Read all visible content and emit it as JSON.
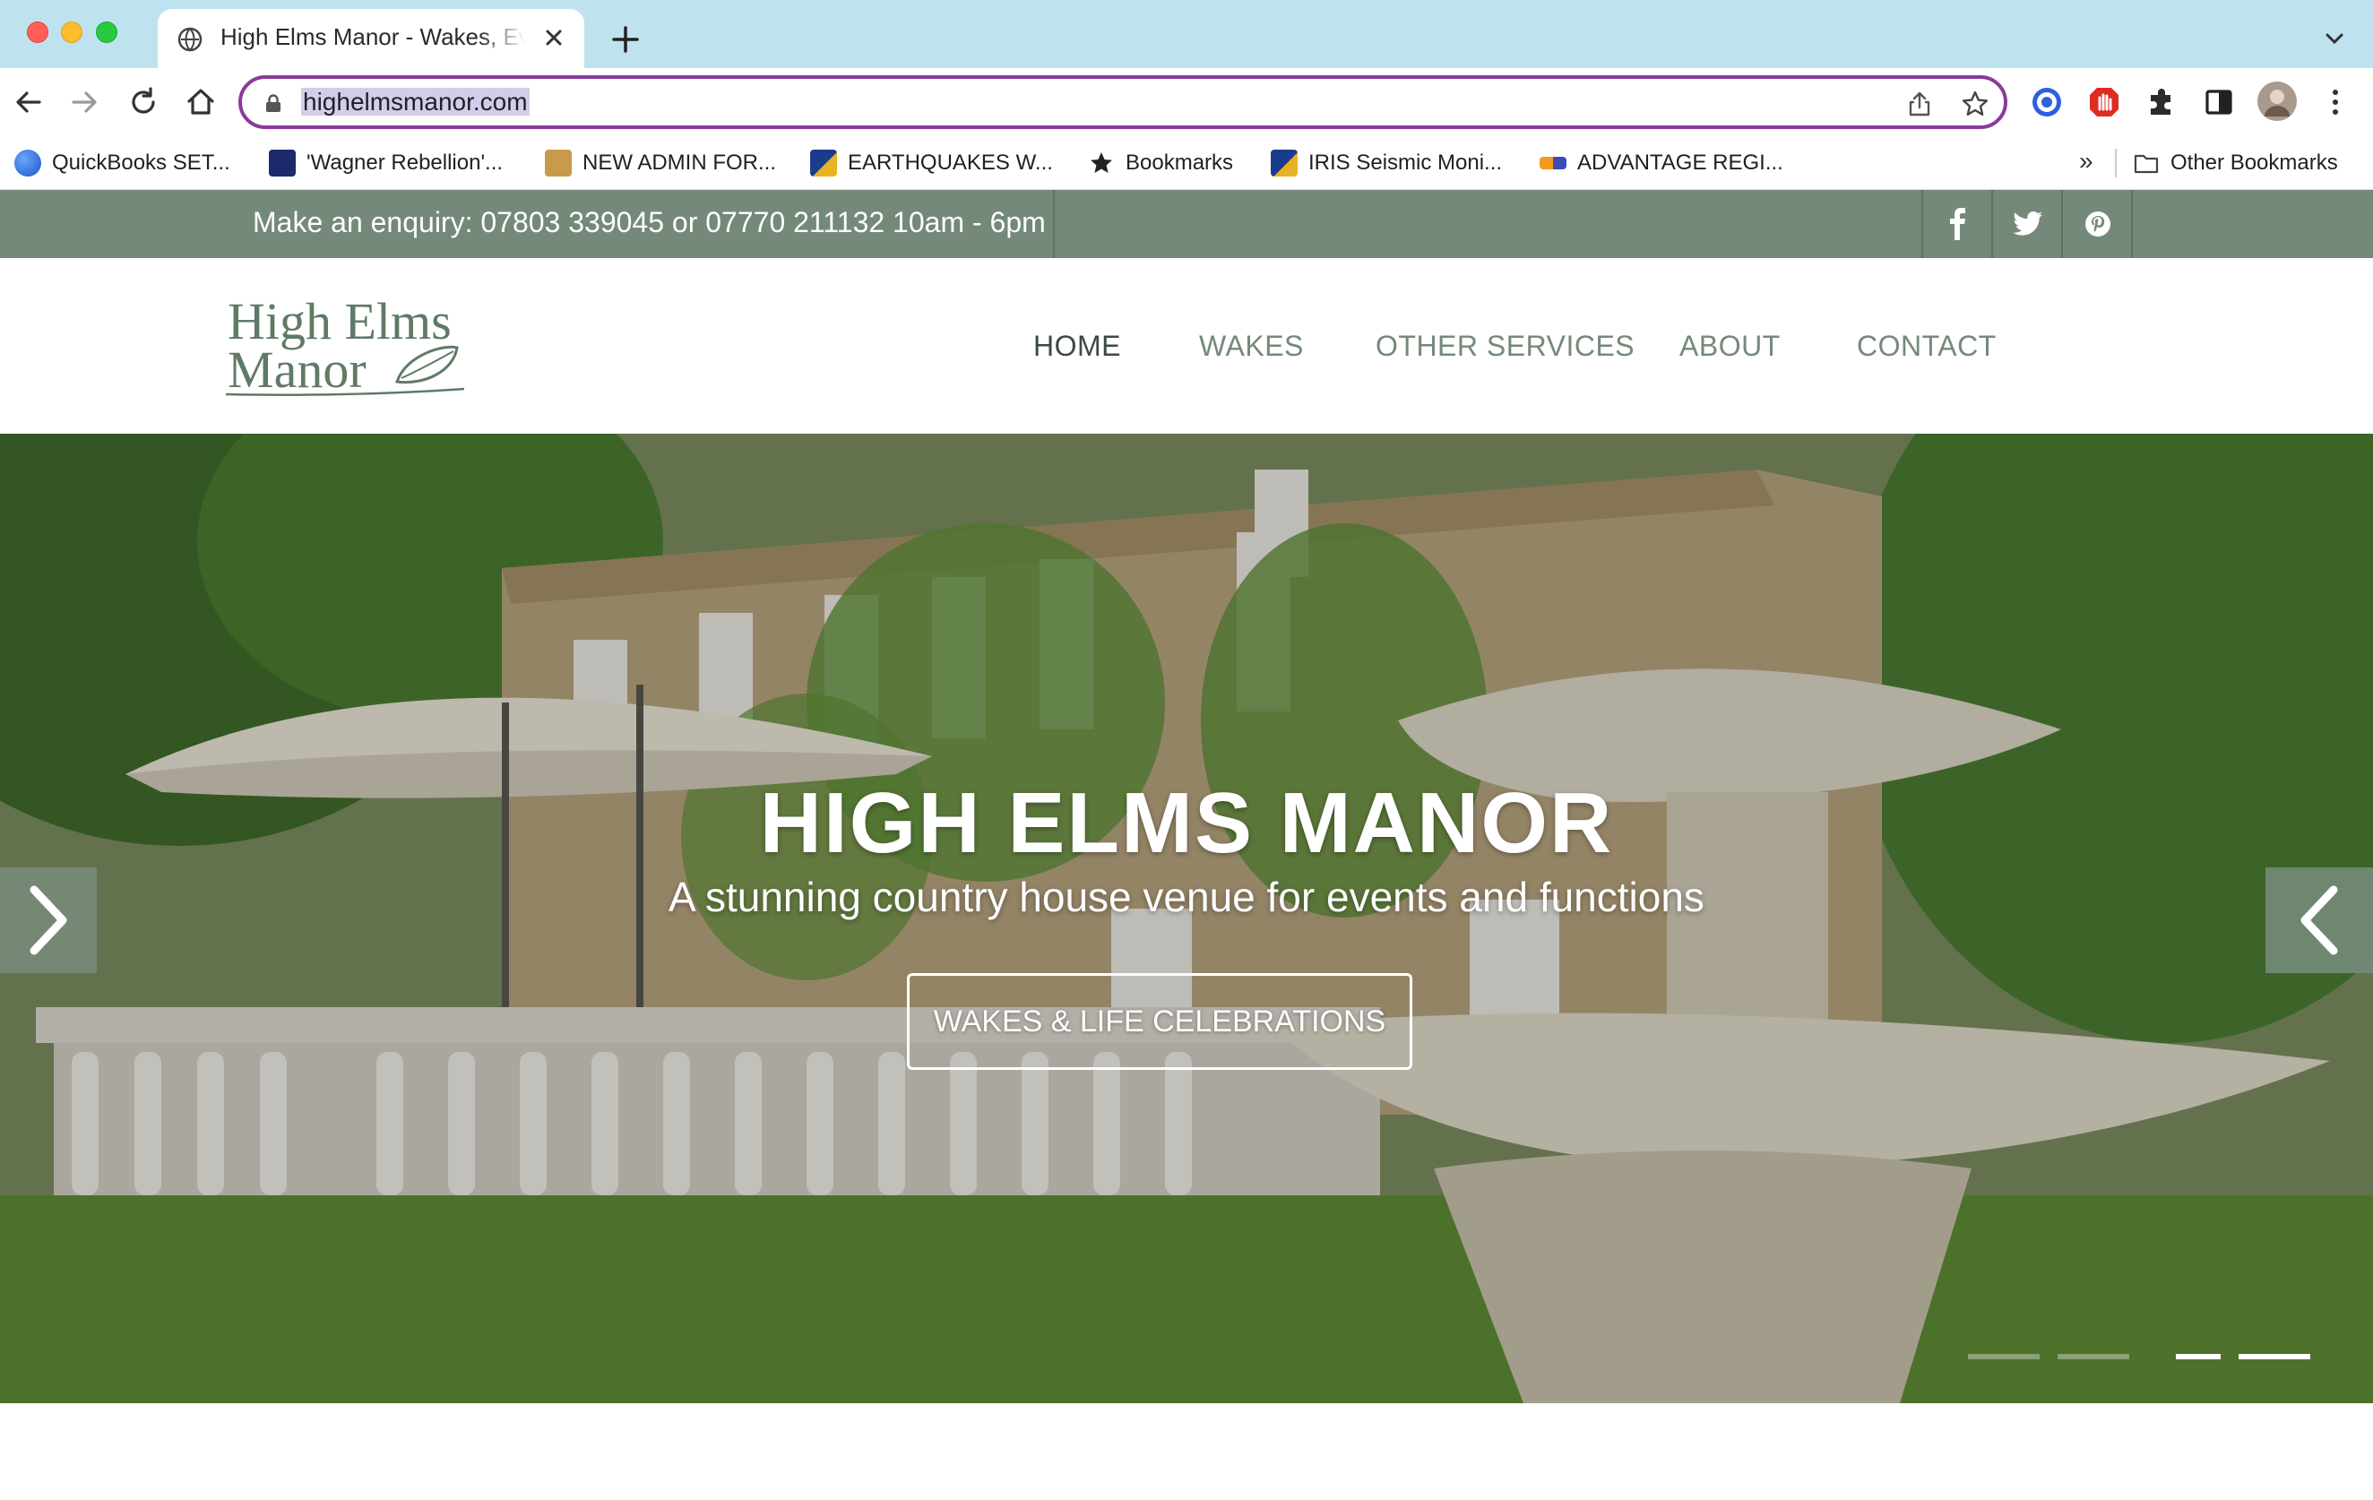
{
  "browser": {
    "tab_title": "High Elms Manor - Wakes, Events & Functions",
    "url": "highelmsmanor.com",
    "bookmarks": [
      {
        "label": "QuickBooks SET...",
        "icon": "quickbooks-icon"
      },
      {
        "label": "'Wagner Rebellion'...",
        "icon": "news-icon"
      },
      {
        "label": "NEW ADMIN FOR...",
        "icon": "admin-icon"
      },
      {
        "label": "EARTHQUAKES W...",
        "icon": "earthquake-icon"
      },
      {
        "label": "Bookmarks",
        "icon": "star-icon"
      },
      {
        "label": "IRIS Seismic Moni...",
        "icon": "seismic-icon"
      },
      {
        "label": "ADVANTAGE REGI...",
        "icon": "advantage-icon"
      }
    ],
    "more_bookmarks": "»",
    "other_bookmarks": "Other Bookmarks"
  },
  "site": {
    "enquiry": "Make an enquiry: 07803 339045 or 07770 211132 10am - 6pm",
    "logo_line1": "High Elms",
    "logo_line2": "Manor",
    "nav": [
      "HOME",
      "WAKES",
      "OTHER SERVICES",
      "ABOUT",
      "CONTACT"
    ],
    "active_nav": "HOME",
    "hero": {
      "title": "HIGH ELMS MANOR",
      "subtitle": "A stunning country house venue for events and functions",
      "button": "WAKES & LIFE CELEBRATIONS",
      "slides": 4,
      "active_slides": [
        3,
        4
      ]
    }
  },
  "colors": {
    "brand_green": "#74897a",
    "omnibox_border": "#8b3a9c",
    "tabbar": "#bfe3ee"
  }
}
